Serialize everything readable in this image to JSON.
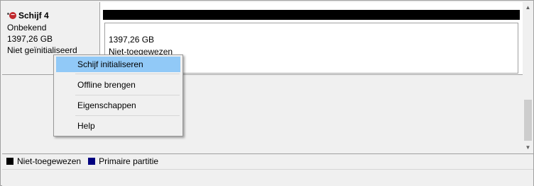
{
  "disk": {
    "title": "Schijf 4",
    "type": "Onbekend",
    "size": "1397,26 GB",
    "status": "Niet geïnitialiseerd"
  },
  "partition": {
    "size": "1397,26 GB",
    "status": "Niet-toegewezen",
    "bar_color": "#000000"
  },
  "context_menu": {
    "items": [
      {
        "label": "Schijf initialiseren",
        "highlighted": true
      },
      {
        "label": "Offline brengen"
      },
      {
        "label": "Eigenschappen"
      },
      {
        "label": "Help"
      }
    ]
  },
  "legend": {
    "items": [
      {
        "label": "Niet-toegewezen",
        "color": "#000000"
      },
      {
        "label": "Primaire partitie",
        "color": "#000080"
      }
    ]
  },
  "icons": {
    "disk_error_icon": "disk-error-icon",
    "scroll_up_icon": "▲",
    "scroll_down_icon": "▼"
  },
  "colors": {
    "highlight": "#91c9f7",
    "error_badge": "#c0282d"
  }
}
